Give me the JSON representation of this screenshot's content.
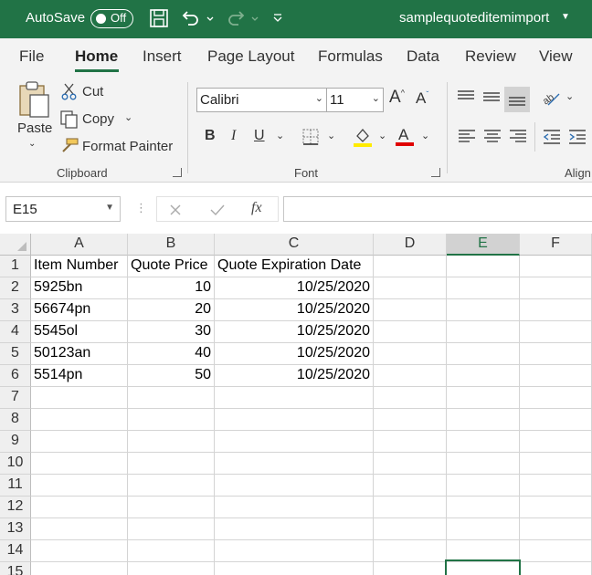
{
  "titlebar": {
    "autosave_label": "AutoSave",
    "toggle_state": "Off",
    "filename": "samplequoteditemimport",
    "colors": {
      "accent": "#217346"
    },
    "icons": [
      "save-icon",
      "undo-icon",
      "redo-icon",
      "customize-quick-access-icon"
    ]
  },
  "tabs": [
    "File",
    "Home",
    "Insert",
    "Page Layout",
    "Formulas",
    "Data",
    "Review",
    "View"
  ],
  "active_tab": "Home",
  "ribbon": {
    "clipboard": {
      "paste": "Paste",
      "cut": "Cut",
      "copy": "Copy",
      "format_painter": "Format Painter",
      "group_label": "Clipboard"
    },
    "font": {
      "font_name": "Calibri",
      "font_size": "11",
      "bold": "B",
      "italic": "I",
      "underline": "U",
      "group_label": "Font"
    },
    "alignment": {
      "group_label": "Align"
    }
  },
  "formula_bar": {
    "name_box": "E15",
    "fx_label": "fx",
    "formula": ""
  },
  "grid": {
    "columns": [
      "A",
      "B",
      "C",
      "D",
      "E",
      "F"
    ],
    "selected_column": "E",
    "row_numbers": [
      "1",
      "2",
      "3",
      "4",
      "5",
      "6",
      "7",
      "8",
      "9",
      "10",
      "11",
      "12",
      "13",
      "14",
      "15"
    ],
    "header_row": [
      "Item Number",
      "Quote Price",
      "Quote Expiration Date"
    ],
    "data_rows": [
      [
        "5925bn",
        "10",
        "10/25/2020"
      ],
      [
        "56674pn",
        "20",
        "10/25/2020"
      ],
      [
        "5545ol",
        "30",
        "10/25/2020"
      ],
      [
        "50123an",
        "40",
        "10/25/2020"
      ],
      [
        "5514pn",
        "50",
        "10/25/2020"
      ]
    ],
    "active_cell": "E15"
  }
}
